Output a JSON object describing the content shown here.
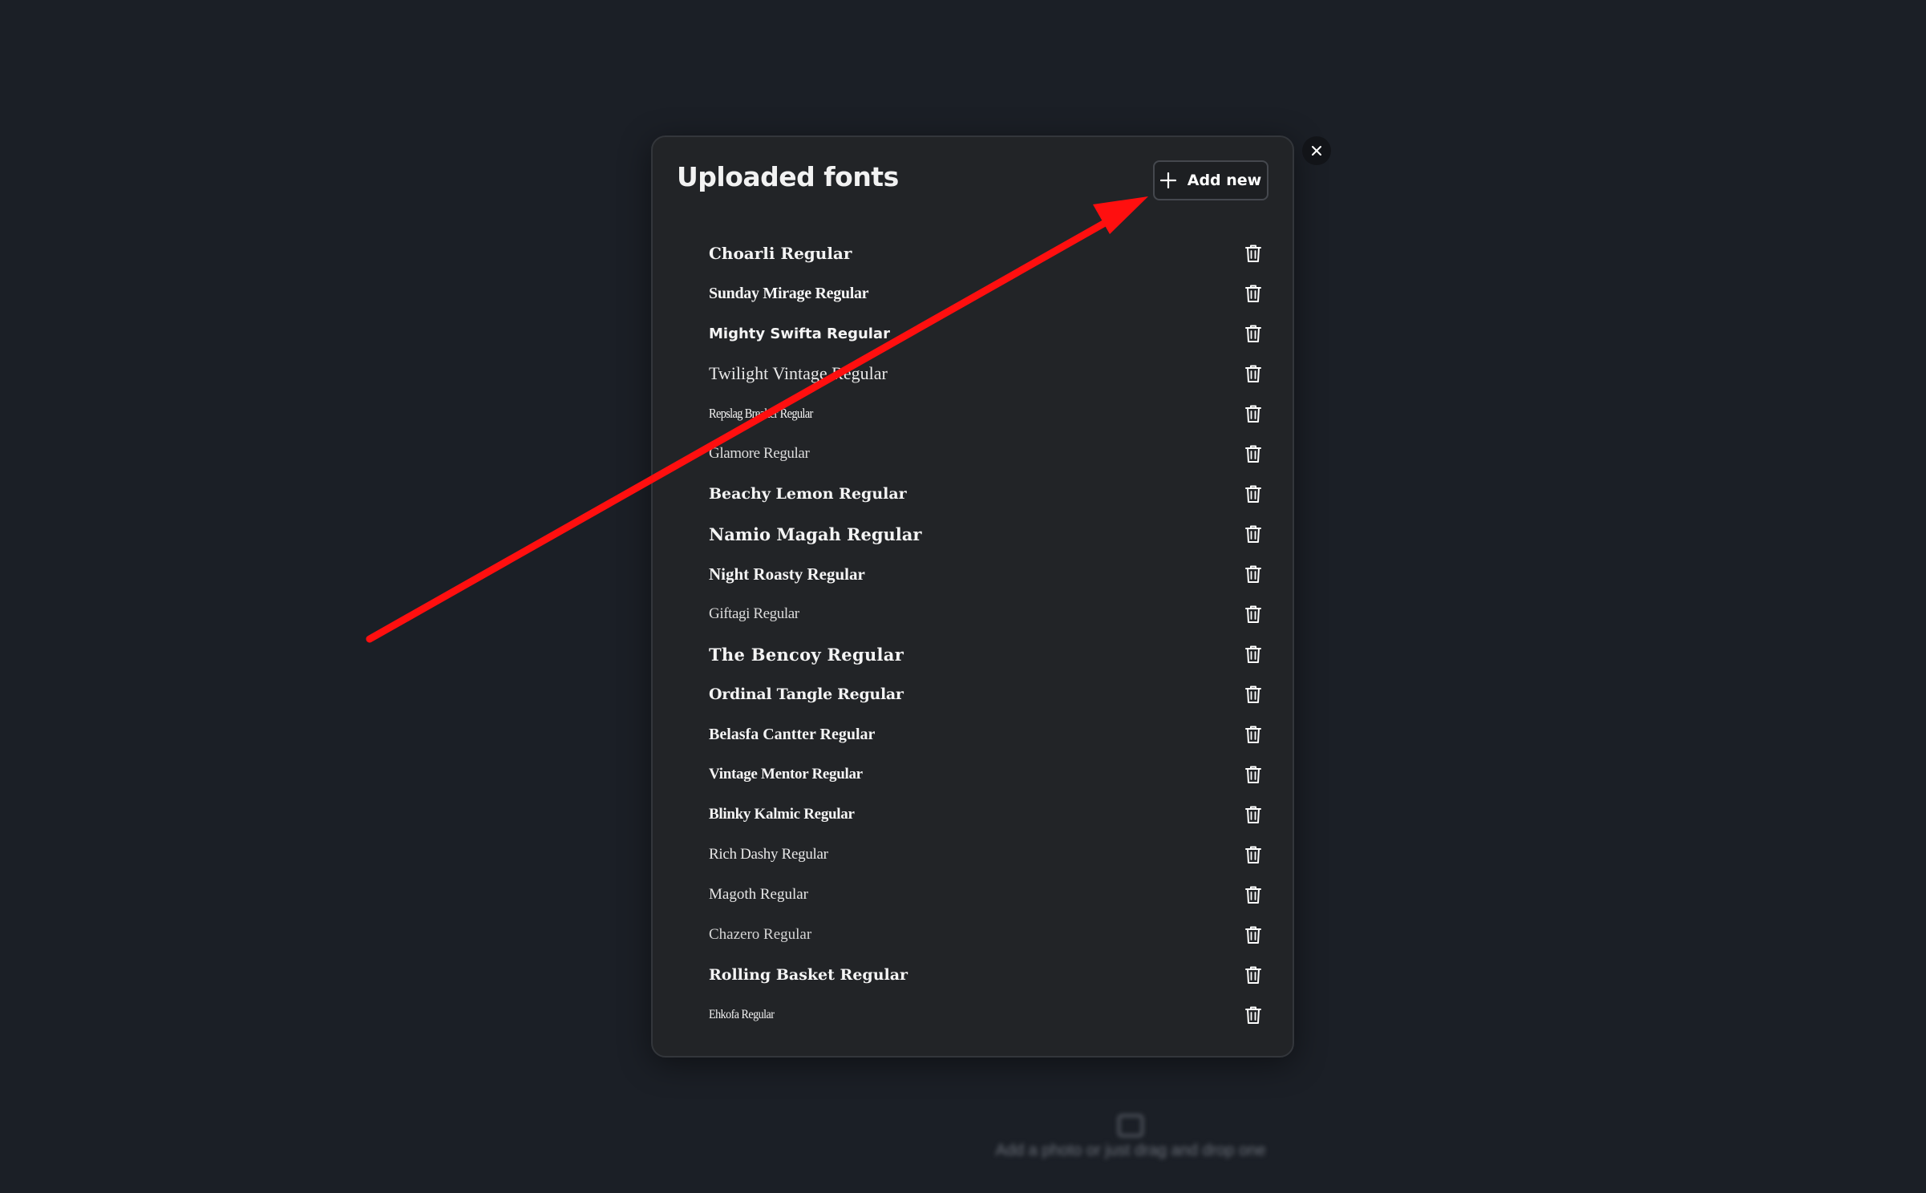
{
  "background": {
    "hint_text": "Add a photo or just drag and drop one"
  },
  "modal": {
    "title": "Uploaded fonts",
    "add_button_label": "Add new",
    "fonts": [
      "Choarli Regular",
      "Sunday Mirage Regular",
      "Mighty Swifta Regular",
      "Twilight Vintage Regular",
      "Repslag Breaker Regular",
      "Glamore Regular",
      "Beachy Lemon Regular",
      "Namio Magah Regular",
      "Night Roasty Regular",
      "Giftagi Regular",
      "The Bencoy Regular",
      "Ordinal Tangle Regular",
      "Belasfa Cantter Regular",
      "Vintage Mentor Regular",
      "Blinky Kalmic Regular",
      "Rich Dashy Regular",
      "Magoth Regular",
      "Chazero Regular",
      "Rolling Basket Regular",
      "Ehkofa Regular"
    ]
  },
  "icons": {
    "add": "plus-icon",
    "delete": "trash-icon",
    "close": "close-icon"
  },
  "colors": {
    "page_background": "#1b1f26",
    "modal_background": "#222427",
    "text": "#f4f4f4",
    "annotation_arrow": "#ff0f0f"
  }
}
